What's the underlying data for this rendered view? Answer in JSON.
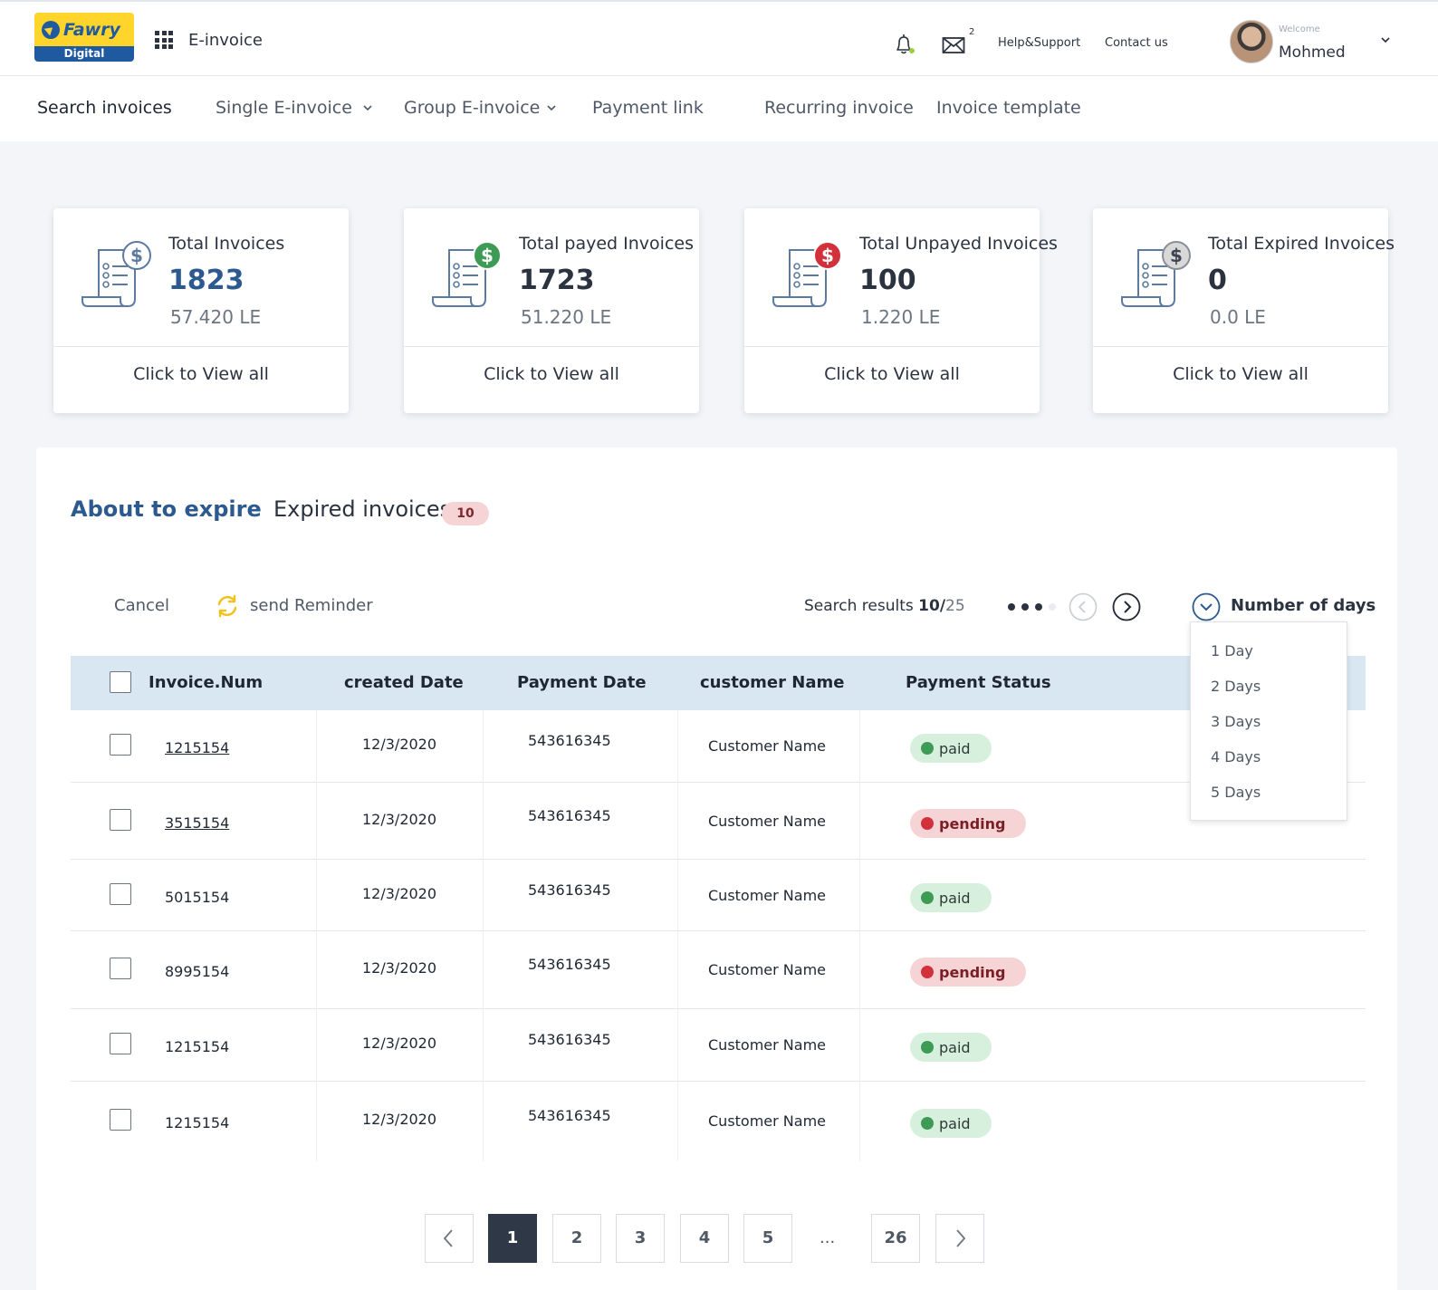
{
  "header": {
    "logo_word": "Fawry",
    "logo_sub": "Digital",
    "app_name": "E-invoice",
    "mail_count": "2",
    "help": "Help&Support",
    "contact": "Contact us",
    "welcome": "Welcome",
    "user": "Mohmed",
    "icons": [
      "apps-grid-icon",
      "bell-icon",
      "mail-icon",
      "chevron-down-icon"
    ]
  },
  "nav": {
    "items": [
      "Search invoices",
      "Single E-invoice",
      "Group E-invoice",
      "Payment link",
      "Recurring invoice",
      "Invoice template"
    ]
  },
  "cards": [
    {
      "title": "Total Invoices",
      "count": "1823",
      "amount": "57.420 LE",
      "link": "Click to View all",
      "icon": "invoice-dollar-icon",
      "badge_color": "#ffffff"
    },
    {
      "title": "Total payed Invoices",
      "count": "1723",
      "amount": "51.220 LE",
      "link": "Click to View all",
      "icon": "invoice-paid-icon",
      "badge_color": "#3e9b55"
    },
    {
      "title": "Total Unpayed Invoices",
      "count": "100",
      "amount": "1.220 LE",
      "link": "Click to View all",
      "icon": "invoice-unpaid-icon",
      "badge_color": "#d2303a"
    },
    {
      "title": "Total Expired  Invoices",
      "count": "0",
      "amount": "0.0 LE",
      "link": "Click to View all",
      "icon": "invoice-expired-icon",
      "badge_color": "#d8d8d8"
    }
  ],
  "tabs": {
    "about": "About to expire",
    "expired": "Expired invoices",
    "expired_count": "10"
  },
  "toolbar": {
    "cancel": "Cancel",
    "reminder": "send Reminder",
    "search_prefix": "Search results ",
    "search_shown": "10/",
    "search_total": "25",
    "days_label": "Number of days"
  },
  "days_options": [
    "1 Day",
    "2 Days",
    "3 Days",
    "4 Days",
    "5 Days"
  ],
  "table": {
    "columns": [
      "Invoice.Num",
      "created Date",
      "Payment Date",
      "customer Name",
      "Payment Status"
    ],
    "rows": [
      {
        "invoice": "1215154",
        "created": "12/3/2020",
        "payment": "543616345",
        "customer": "Customer Name",
        "status": "paid"
      },
      {
        "invoice": "3515154",
        "created": "12/3/2020",
        "payment": "543616345",
        "customer": "Customer Name",
        "status": "pending"
      },
      {
        "invoice": "5015154",
        "created": "12/3/2020",
        "payment": "543616345",
        "customer": "Customer Name",
        "status": "paid"
      },
      {
        "invoice": "8995154",
        "created": "12/3/2020",
        "payment": "543616345",
        "customer": "Customer Name",
        "status": "pending"
      },
      {
        "invoice": "1215154",
        "created": "12/3/2020",
        "payment": "543616345",
        "customer": "Customer Name",
        "status": "paid"
      },
      {
        "invoice": "1215154",
        "created": "12/3/2020",
        "payment": "543616345",
        "customer": "Customer Name",
        "status": "paid"
      }
    ]
  },
  "pagination": {
    "pages": [
      "1",
      "2",
      "3",
      "4",
      "5"
    ],
    "ellipsis": "...",
    "last": "26",
    "current": "1"
  },
  "colors": {
    "brand_yellow": "#ffd52b",
    "brand_blue": "#1f5aa0",
    "accent": "#2c5a8f",
    "header_row": "#d9e7f3",
    "paid_bg": "#d7f0de",
    "pending_bg": "#f6d4d6"
  }
}
